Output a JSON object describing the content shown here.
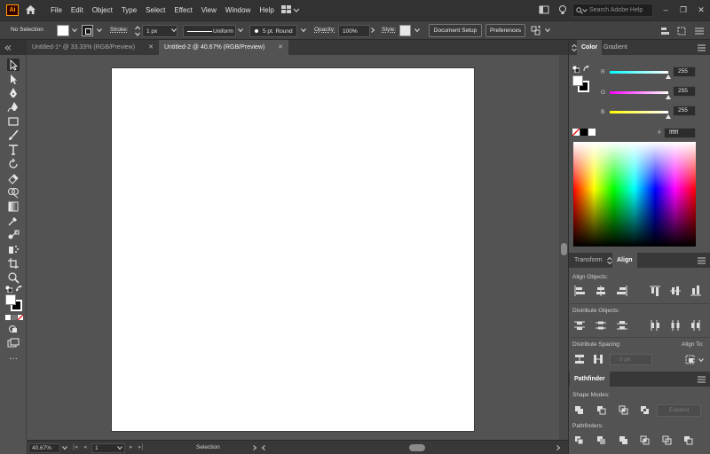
{
  "app": {
    "logo": "Ai",
    "menu": [
      "File",
      "Edit",
      "Object",
      "Type",
      "Select",
      "Effect",
      "View",
      "Window",
      "Help"
    ],
    "help_search_placeholder": "Search Adobe Help"
  },
  "control_bar": {
    "selection": "No Selection",
    "stroke_label": "Stroke:",
    "stroke_weight": "1 px",
    "stroke_profile": "Uniform",
    "brush": "5 pt. Round",
    "opacity_label": "Opacity:",
    "opacity_value": "100%",
    "style_label": "Style:",
    "document_setup": "Document Setup",
    "preferences": "Preferences"
  },
  "tabs": [
    {
      "label": "Untitled-1* @ 33.33% (RGB/Preview)",
      "active": false
    },
    {
      "label": "Untitled-2 @ 40.67% (RGB/Preview)",
      "active": true
    }
  ],
  "status_bar": {
    "zoom": "40.67%",
    "artboard": "1",
    "tool": "Selection"
  },
  "color_panel": {
    "tabs": [
      "Color",
      "Gradient"
    ],
    "r": {
      "label": "R",
      "value": "255",
      "fraction": 1.0
    },
    "g": {
      "label": "G",
      "value": "255",
      "fraction": 1.0
    },
    "b": {
      "label": "B",
      "value": "255",
      "fraction": 1.0
    },
    "hex_prefix": "#",
    "hex": "ffffff"
  },
  "align_panel": {
    "tabs": [
      "Transform",
      "Align"
    ],
    "align_objects": "Align Objects:",
    "distribute_objects": "Distribute Objects:",
    "distribute_spacing": "Distribute Spacing:",
    "align_to": "Align To:",
    "spacing_value": "0 px"
  },
  "pathfinder_panel": {
    "tab": "Pathfinder",
    "shape_modes": "Shape Modes:",
    "expand": "Expand",
    "pathfinders": "Pathfinders:"
  },
  "colors": {
    "menubar": "#323232",
    "panel": "#535353",
    "accent_logo": "#ff9a00"
  }
}
